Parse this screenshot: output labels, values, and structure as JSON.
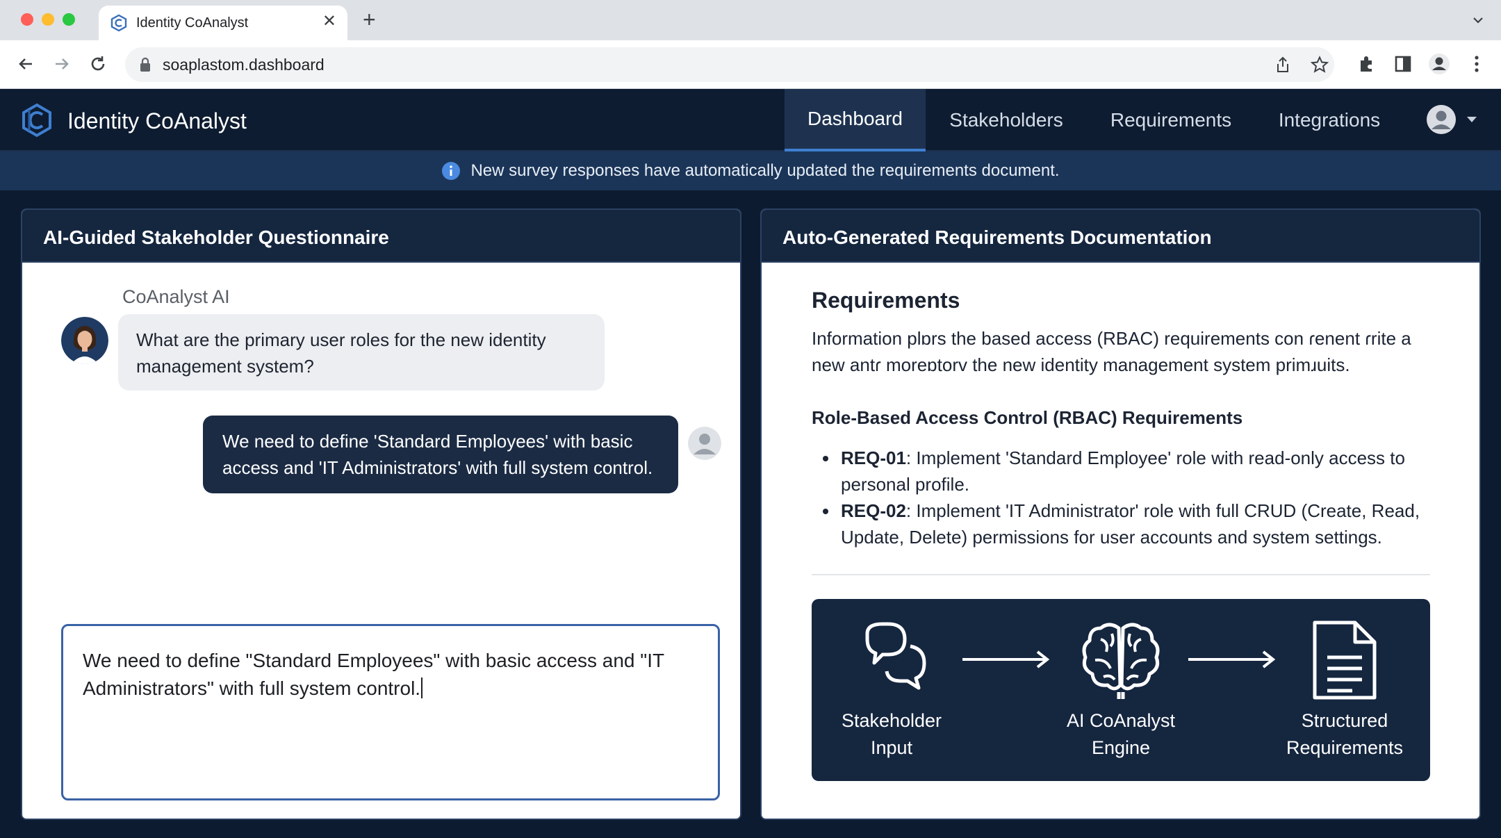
{
  "browser": {
    "tab_title": "Identity CoAnalyst",
    "url": "soaplastom.dashboard",
    "icons": [
      "back-arrow-icon",
      "forward-arrow-icon",
      "reload-icon",
      "lock-icon",
      "share-icon",
      "star-icon",
      "extensions-icon",
      "sidebar-icon",
      "profile-icon",
      "more-icon"
    ]
  },
  "app": {
    "title": "Identity CoAnalyst",
    "nav": [
      {
        "label": "Dashboard",
        "active": true
      },
      {
        "label": "Stakeholders",
        "active": false
      },
      {
        "label": "Requirements",
        "active": false
      },
      {
        "label": "Integrations",
        "active": false
      }
    ]
  },
  "notice": {
    "text": "New survey responses have automatically updated the requirements document."
  },
  "questionnaire": {
    "title": "AI-Guided Stakeholder Questionnaire",
    "ai_name": "CoAnalyst AI",
    "ai_message": "What are the primary user roles for the new identity management system?",
    "user_message": "We need to define 'Standard Employees' with basic access and 'IT Administrators' with full system control.",
    "input_value": "We need to define \"Standard Employees\" with basic access and \"IT Administrators\" with full system control."
  },
  "requirements": {
    "panel_title": "Auto-Generated Requirements Documentation",
    "heading": "Requirements",
    "intro": "Information plɒrs the based access (RBAC) requirements con ɾenent ɾrite a new antɾ moreɒtorv the new identity management system primɹuits.",
    "section_heading": "Role-Based Access Control (RBAC) Requirements",
    "items": [
      {
        "id": "REQ-01",
        "text": ": Implement 'Standard Employee' role with read-only access to personal profile."
      },
      {
        "id": "REQ-02",
        "text": ": Implement 'IT Administrator' role with full CRUD (Create, Read, Update, Delete) permissions for user accounts and system settings."
      }
    ],
    "flow": [
      {
        "label_1": "Stakeholder",
        "label_2": "Input",
        "icon": "chat-bubbles-icon"
      },
      {
        "label_1": "AI CoAnalyst",
        "label_2": "Engine",
        "icon": "brain-icon"
      },
      {
        "label_1": "Structured",
        "label_2": "Requirements",
        "icon": "document-icon"
      }
    ]
  },
  "colors": {
    "app_bg": "#0d1b30",
    "header_bg": "#0e1c31",
    "accent": "#3f7fd0",
    "notice_bg": "#1b3558",
    "user_bubble": "#1b2b44"
  }
}
